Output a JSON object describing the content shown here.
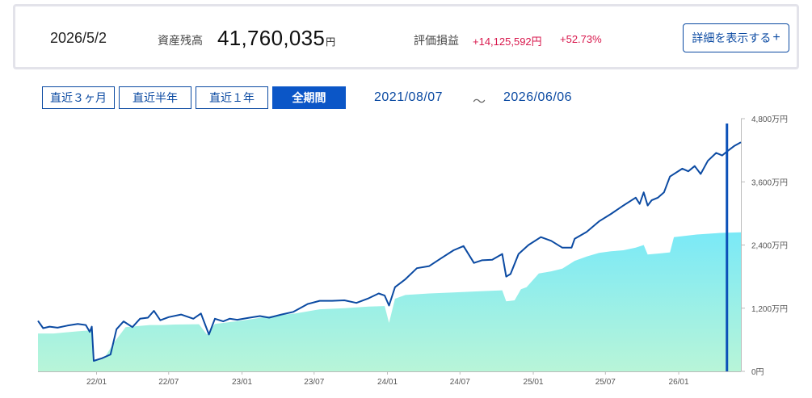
{
  "summary": {
    "date": "2026/5/2",
    "asset_label": "資産残高",
    "asset_value": "41,760,035",
    "asset_unit": "円",
    "pl_label": "評価損益",
    "pl_amount": "+14,125,592円",
    "pl_rate": "+52.73%",
    "detail_button": "詳細を表示する",
    "detail_icon": "+"
  },
  "periods": [
    {
      "label": "直近３ヶ月",
      "active": false
    },
    {
      "label": "直近半年",
      "active": false
    },
    {
      "label": "直近１年",
      "active": false
    },
    {
      "label": "全期間",
      "active": true
    }
  ],
  "range": {
    "start": "2021/08/07",
    "sep": "～",
    "end": "2026/06/06"
  },
  "colors": {
    "line": "#0b4aa2",
    "cursor": "#0b50b8",
    "area_top": "#7ae9f7",
    "area_bottom": "#b8f5d8",
    "accent": "#0b56c7",
    "positive": "#d8174c"
  },
  "chart_data": {
    "type": "area",
    "y_unit": "万円",
    "ylim": [
      0,
      4800
    ],
    "y_ticks": [
      {
        "value": 0,
        "label": "0円"
      },
      {
        "value": 1200,
        "label": "1,200万円"
      },
      {
        "value": 2400,
        "label": "2,400万円"
      },
      {
        "value": 3600,
        "label": "3,600万円"
      },
      {
        "value": 4800,
        "label": "4,800万円"
      }
    ],
    "xlim": [
      "2021-08-07",
      "2026-06-06"
    ],
    "x_ticks": [
      {
        "date": "2022-01-01",
        "label": "22/01"
      },
      {
        "date": "2022-07-01",
        "label": "22/07"
      },
      {
        "date": "2023-01-01",
        "label": "23/01"
      },
      {
        "date": "2023-07-01",
        "label": "23/07"
      },
      {
        "date": "2024-01-01",
        "label": "24/01"
      },
      {
        "date": "2024-07-01",
        "label": "24/07"
      },
      {
        "date": "2025-01-01",
        "label": "25/01"
      },
      {
        "date": "2025-07-01",
        "label": "25/07"
      },
      {
        "date": "2026-01-01",
        "label": "26/01"
      }
    ],
    "cursor_date": "2026-05-02",
    "series": [
      {
        "role": "asset",
        "points": [
          [
            "2021-08-07",
            960
          ],
          [
            "2021-08-20",
            820
          ],
          [
            "2021-09-05",
            850
          ],
          [
            "2021-09-25",
            830
          ],
          [
            "2021-10-20",
            870
          ],
          [
            "2021-11-15",
            900
          ],
          [
            "2021-12-05",
            880
          ],
          [
            "2021-12-15",
            750
          ],
          [
            "2021-12-20",
            850
          ],
          [
            "2021-12-25",
            200
          ],
          [
            "2022-01-15",
            250
          ],
          [
            "2022-02-05",
            320
          ],
          [
            "2022-02-20",
            800
          ],
          [
            "2022-03-10",
            950
          ],
          [
            "2022-04-01",
            840
          ],
          [
            "2022-04-20",
            1000
          ],
          [
            "2022-05-10",
            1020
          ],
          [
            "2022-05-25",
            1150
          ],
          [
            "2022-06-10",
            970
          ],
          [
            "2022-07-01",
            1030
          ],
          [
            "2022-08-01",
            1080
          ],
          [
            "2022-09-01",
            1000
          ],
          [
            "2022-09-20",
            1100
          ],
          [
            "2022-10-01",
            880
          ],
          [
            "2022-10-10",
            700
          ],
          [
            "2022-10-25",
            1000
          ],
          [
            "2022-11-15",
            950
          ],
          [
            "2022-12-01",
            1000
          ],
          [
            "2022-12-20",
            980
          ],
          [
            "2023-01-20",
            1020
          ],
          [
            "2023-02-15",
            1050
          ],
          [
            "2023-03-10",
            1020
          ],
          [
            "2023-04-10",
            1080
          ],
          [
            "2023-05-10",
            1130
          ],
          [
            "2023-06-15",
            1280
          ],
          [
            "2023-07-15",
            1340
          ],
          [
            "2023-08-15",
            1340
          ],
          [
            "2023-09-15",
            1350
          ],
          [
            "2023-10-15",
            1300
          ],
          [
            "2023-11-15",
            1390
          ],
          [
            "2023-12-10",
            1480
          ],
          [
            "2023-12-25",
            1440
          ],
          [
            "2024-01-05",
            1250
          ],
          [
            "2024-01-20",
            1600
          ],
          [
            "2024-02-15",
            1750
          ],
          [
            "2024-03-15",
            1960
          ],
          [
            "2024-04-15",
            2000
          ],
          [
            "2024-05-15",
            2150
          ],
          [
            "2024-06-15",
            2300
          ],
          [
            "2024-07-10",
            2380
          ],
          [
            "2024-08-05",
            2060
          ],
          [
            "2024-08-25",
            2110
          ],
          [
            "2024-09-20",
            2120
          ],
          [
            "2024-10-15",
            2230
          ],
          [
            "2024-10-25",
            1800
          ],
          [
            "2024-11-05",
            1850
          ],
          [
            "2024-11-25",
            2230
          ],
          [
            "2024-12-20",
            2400
          ],
          [
            "2025-01-20",
            2550
          ],
          [
            "2025-02-15",
            2480
          ],
          [
            "2025-03-15",
            2350
          ],
          [
            "2025-04-07",
            2350
          ],
          [
            "2025-04-15",
            2520
          ],
          [
            "2025-05-15",
            2650
          ],
          [
            "2025-06-15",
            2850
          ],
          [
            "2025-07-15",
            2990
          ],
          [
            "2025-08-15",
            3150
          ],
          [
            "2025-09-15",
            3300
          ],
          [
            "2025-09-25",
            3180
          ],
          [
            "2025-10-05",
            3400
          ],
          [
            "2025-10-15",
            3150
          ],
          [
            "2025-10-25",
            3250
          ],
          [
            "2025-11-10",
            3300
          ],
          [
            "2025-11-25",
            3400
          ],
          [
            "2025-12-10",
            3700
          ],
          [
            "2026-01-10",
            3850
          ],
          [
            "2026-01-25",
            3800
          ],
          [
            "2026-02-10",
            3900
          ],
          [
            "2026-02-25",
            3750
          ],
          [
            "2026-03-15",
            4000
          ],
          [
            "2026-04-05",
            4150
          ],
          [
            "2026-04-20",
            4100
          ],
          [
            "2026-05-02",
            4176
          ],
          [
            "2026-05-20",
            4280
          ],
          [
            "2026-06-06",
            4350
          ]
        ]
      },
      {
        "role": "principal",
        "points": [
          [
            "2021-08-07",
            720
          ],
          [
            "2021-09-15",
            720
          ],
          [
            "2021-10-15",
            740
          ],
          [
            "2021-11-15",
            760
          ],
          [
            "2021-12-20",
            780
          ],
          [
            "2021-12-25",
            200
          ],
          [
            "2022-01-20",
            250
          ],
          [
            "2022-02-15",
            560
          ],
          [
            "2022-03-15",
            840
          ],
          [
            "2022-04-15",
            860
          ],
          [
            "2022-05-15",
            880
          ],
          [
            "2022-06-15",
            880
          ],
          [
            "2022-07-15",
            890
          ],
          [
            "2022-09-15",
            895
          ],
          [
            "2022-10-05",
            700
          ],
          [
            "2022-10-25",
            900
          ],
          [
            "2022-11-15",
            920
          ],
          [
            "2022-12-15",
            950
          ],
          [
            "2023-01-15",
            980
          ],
          [
            "2023-03-15",
            1050
          ],
          [
            "2023-05-15",
            1100
          ],
          [
            "2023-07-15",
            1180
          ],
          [
            "2023-09-15",
            1200
          ],
          [
            "2023-11-15",
            1230
          ],
          [
            "2023-12-25",
            1240
          ],
          [
            "2024-01-05",
            920
          ],
          [
            "2024-01-20",
            1380
          ],
          [
            "2024-02-15",
            1450
          ],
          [
            "2024-04-15",
            1480
          ],
          [
            "2024-06-15",
            1500
          ],
          [
            "2024-08-15",
            1520
          ],
          [
            "2024-10-15",
            1540
          ],
          [
            "2024-10-25",
            1330
          ],
          [
            "2024-11-15",
            1350
          ],
          [
            "2024-12-01",
            1560
          ],
          [
            "2024-12-15",
            1600
          ],
          [
            "2025-01-15",
            1860
          ],
          [
            "2025-02-15",
            1900
          ],
          [
            "2025-03-15",
            1950
          ],
          [
            "2025-04-15",
            2100
          ],
          [
            "2025-05-15",
            2180
          ],
          [
            "2025-06-15",
            2250
          ],
          [
            "2025-07-15",
            2280
          ],
          [
            "2025-08-15",
            2300
          ],
          [
            "2025-09-15",
            2350
          ],
          [
            "2025-10-05",
            2400
          ],
          [
            "2025-10-15",
            2220
          ],
          [
            "2025-11-15",
            2240
          ],
          [
            "2025-12-10",
            2260
          ],
          [
            "2025-12-20",
            2550
          ],
          [
            "2026-02-15",
            2600
          ],
          [
            "2026-04-15",
            2630
          ],
          [
            "2026-06-06",
            2640
          ]
        ]
      }
    ]
  }
}
